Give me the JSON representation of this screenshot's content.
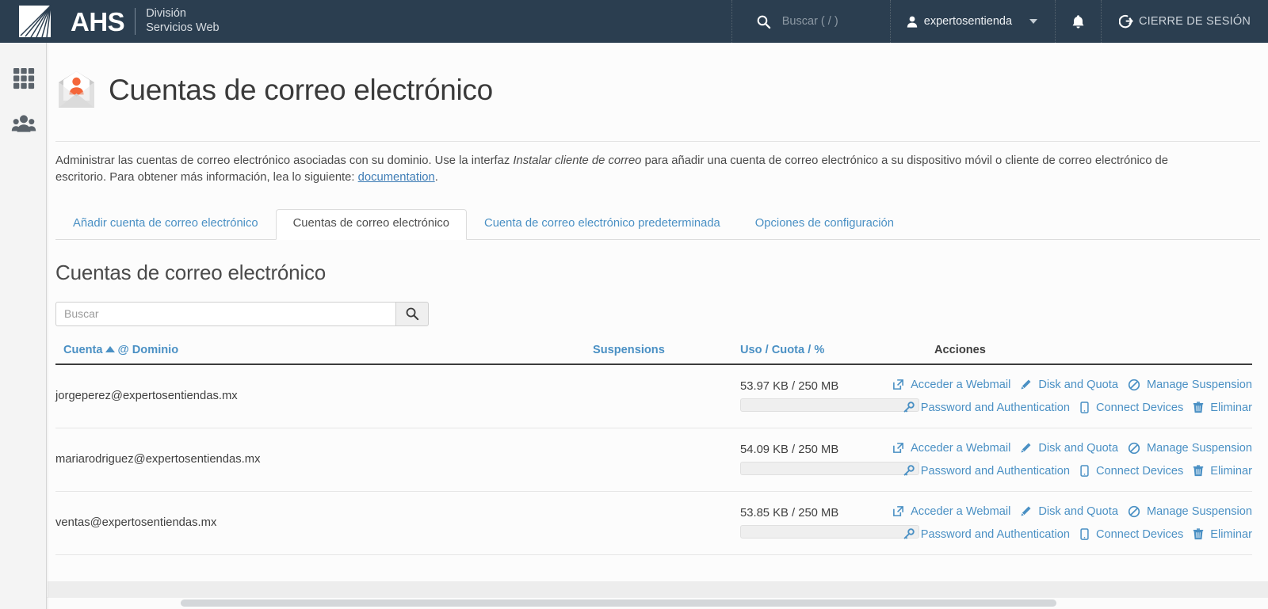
{
  "topbar": {
    "brand_name": "AHS",
    "brand_sub_line1": "División",
    "brand_sub_line2": "Servicios Web",
    "brand_logo_icon": "ahs-fan-logo",
    "search_icon": "search-icon",
    "search_placeholder": "Buscar ( / )",
    "user_icon": "user-icon",
    "username": "expertosentienda",
    "caret_icon": "chevron-down-icon",
    "bell_icon": "bell-icon",
    "logout_icon": "logout-icon",
    "logout_label": "CIERRE DE SESIÓN"
  },
  "rail": {
    "items": [
      {
        "icon": "grid-apps-icon",
        "name": "apps"
      },
      {
        "icon": "users-group-icon",
        "name": "users"
      }
    ]
  },
  "page": {
    "icon": "mail-account-envelope-icon",
    "title": "Cuentas de correo electrónico",
    "desc_part1": "Administrar las cuentas de correo electrónico asociadas con su dominio. Use la interfaz ",
    "desc_em": "Instalar cliente de correo",
    "desc_part2": " para añadir una cuenta de correo electrónico a su dispositivo móvil o cliente de correo electrónico de escritorio. Para obtener más información, lea lo siguiente: ",
    "desc_link": "documentation",
    "desc_part3": "."
  },
  "tabs": [
    {
      "label": "Añadir cuenta de correo electrónico",
      "active": false
    },
    {
      "label": "Cuentas de correo electrónico",
      "active": true
    },
    {
      "label": "Cuenta de correo electrónico predeterminada",
      "active": false
    },
    {
      "label": "Opciones de configuración",
      "active": false
    }
  ],
  "section": {
    "title": "Cuentas de correo electrónico",
    "search_placeholder": "Buscar",
    "search_value": "",
    "search_button_icon": "search-icon"
  },
  "table": {
    "headers": {
      "account": "Cuenta",
      "sort_caret_icon": "sort-asc-caret-icon",
      "at": "@",
      "domain": "Dominio",
      "suspensions": "Suspensions",
      "usage_use": "Uso",
      "usage_sep1": "/",
      "usage_quota": "Cuota",
      "usage_sep2": "/",
      "usage_pct": "%",
      "actions": "Acciones"
    },
    "action_labels": {
      "webmail": "Acceder a Webmail",
      "disk_quota": "Disk and Quota",
      "manage_suspension": "Manage Suspension",
      "password_auth": "Password and Authentication",
      "connect_devices": "Connect Devices",
      "delete": "Eliminar"
    },
    "action_icons": {
      "webmail": "external-link-icon",
      "disk_quota": "pencil-icon",
      "manage_suspension": "ban-circle-slash-icon",
      "password_auth": "key-icon",
      "connect_devices": "mobile-phone-icon",
      "delete": "trash-icon"
    },
    "rows": [
      {
        "account": "jorgeperez@expertosentiendas.mx",
        "suspensions": "",
        "usage": "53.97 KB / 250 MB",
        "usage_percent": 0
      },
      {
        "account": "mariarodriguez@expertosentiendas.mx",
        "suspensions": "",
        "usage": "54.09 KB / 250 MB",
        "usage_percent": 0
      },
      {
        "account": "ventas@expertosentiendas.mx",
        "suspensions": "",
        "usage": "53.85 KB / 250 MB",
        "usage_percent": 0
      }
    ]
  },
  "colors": {
    "topbar_bg": "#2b3e50",
    "link_blue": "#4a90c4",
    "accent_orange": "#f4663a",
    "page_bg": "#fcfcfc"
  }
}
